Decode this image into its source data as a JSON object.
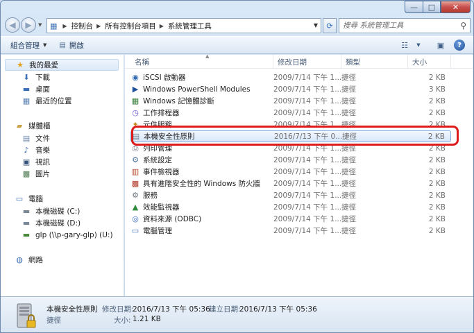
{
  "window": {
    "caption": {
      "minimize": "—",
      "maximize": "□",
      "close": "✕"
    }
  },
  "address": {
    "segments": [
      "控制台",
      "所有控制台項目",
      "系統管理工具"
    ],
    "search_placeholder": "搜尋 系統管理工具"
  },
  "toolbar": {
    "organize_label": "組合管理",
    "open_label": "開啟"
  },
  "nav": {
    "favorites": {
      "label": "我的最愛",
      "items": [
        "下載",
        "桌面",
        "最近的位置"
      ]
    },
    "libraries": {
      "label": "媒體櫃",
      "items": [
        "文件",
        "音樂",
        "視訊",
        "圖片"
      ]
    },
    "computer": {
      "label": "電腦",
      "items": [
        "本機磁碟 (C:)",
        "本機磁碟 (D:)",
        "glp (\\\\p-gary-glp) (U:)"
      ]
    },
    "network": {
      "label": "網路"
    }
  },
  "columns": {
    "name": "名稱",
    "date": "修改日期",
    "type": "類型",
    "size": "大小"
  },
  "files": [
    {
      "name": "iSCSI 啟動器",
      "date": "2009/7/14 下午 1...",
      "type": "捷徑",
      "size": "2 KB",
      "icon": "iscsi-icon"
    },
    {
      "name": "Windows PowerShell Modules",
      "date": "2009/7/14 下午 1...",
      "type": "捷徑",
      "size": "3 KB",
      "icon": "powershell-icon"
    },
    {
      "name": "Windows 記憶體診斷",
      "date": "2009/7/14 下午 1...",
      "type": "捷徑",
      "size": "2 KB",
      "icon": "memory-diagnostic-icon"
    },
    {
      "name": "工作排程器",
      "date": "2009/7/14 下午 1...",
      "type": "捷徑",
      "size": "2 KB",
      "icon": "task-scheduler-icon"
    },
    {
      "name": "元件服務",
      "date": "2009/7/14 下午 1...",
      "type": "捷徑",
      "size": "2 KB",
      "icon": "component-services-icon"
    },
    {
      "name": "本機安全性原則",
      "date": "2016/7/13 下午 0...",
      "type": "捷徑",
      "size": "2 KB",
      "icon": "security-policy-icon",
      "selected": true
    },
    {
      "name": "列印管理",
      "date": "2009/7/14 下午 1...",
      "type": "捷徑",
      "size": "2 KB",
      "icon": "print-management-icon"
    },
    {
      "name": "系統設定",
      "date": "2009/7/14 下午 1...",
      "type": "捷徑",
      "size": "2 KB",
      "icon": "system-config-icon"
    },
    {
      "name": "事件檢視器",
      "date": "2009/7/14 下午 1...",
      "type": "捷徑",
      "size": "2 KB",
      "icon": "event-viewer-icon"
    },
    {
      "name": "具有進階安全性的 Windows 防火牆",
      "date": "2009/7/14 下午 1...",
      "type": "捷徑",
      "size": "2 KB",
      "icon": "firewall-icon"
    },
    {
      "name": "服務",
      "date": "2009/7/14 下午 1...",
      "type": "捷徑",
      "size": "2 KB",
      "icon": "services-icon"
    },
    {
      "name": "效能監視器",
      "date": "2009/7/14 下午 1...",
      "type": "捷徑",
      "size": "2 KB",
      "icon": "performance-monitor-icon"
    },
    {
      "name": "資料來源 (ODBC)",
      "date": "2009/7/14 下午 1...",
      "type": "捷徑",
      "size": "2 KB",
      "icon": "odbc-icon"
    },
    {
      "name": "電腦管理",
      "date": "2009/7/14 下午 1...",
      "type": "捷徑",
      "size": "2 KB",
      "icon": "computer-management-icon"
    }
  ],
  "details": {
    "name": "本機安全性原則",
    "modified_label": "修改日期:",
    "modified_value": "2016/7/13 下午 05:36",
    "created_label": "建立日期:",
    "created_value": "2016/7/13 下午 05:36",
    "type": "捷徑",
    "size_label": "大小:",
    "size_value": "1.21 KB"
  },
  "colors": {
    "highlight": "#e01b1b",
    "selection": "#d8e7fa",
    "accent": "#1e395b"
  }
}
